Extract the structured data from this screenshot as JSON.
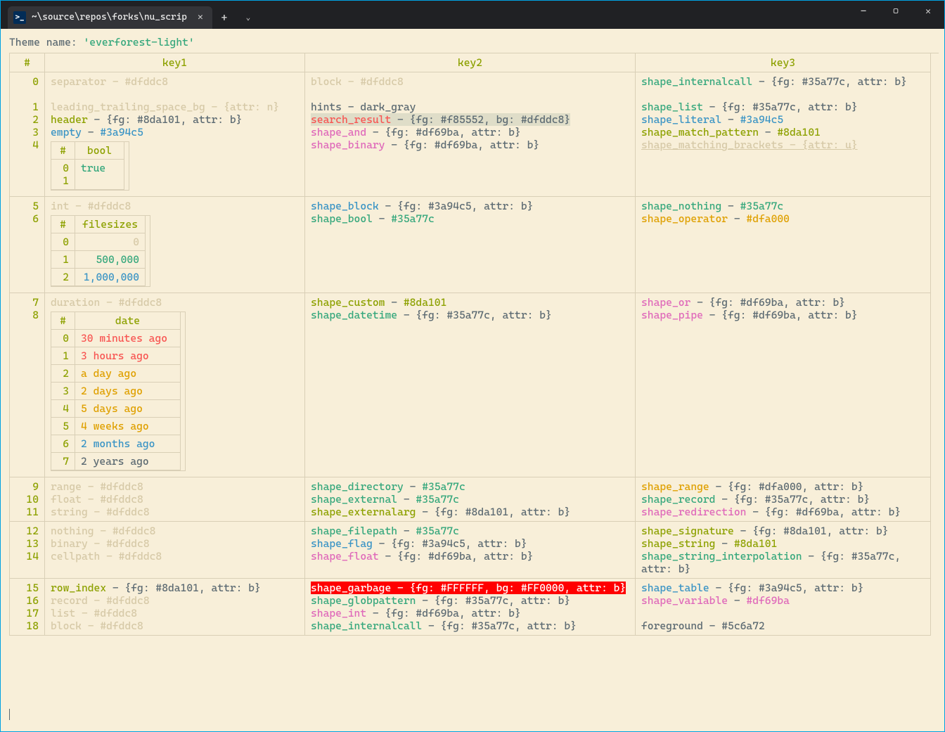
{
  "tab_title": "~\\source\\repos\\forks\\nu_scrip",
  "theme_label": "Theme name:",
  "theme_name": "'everforest-light'",
  "headers": {
    "idx": "#",
    "k1": "key1",
    "k2": "key2",
    "k3": "key3"
  },
  "rows": {
    "r0": "0",
    "r1": "1",
    "r2": "2",
    "r3": "3",
    "r4": "4",
    "r5": "5",
    "r6": "6",
    "r7": "7",
    "r8": "8",
    "r9": "9",
    "r10": "10",
    "r11": "11",
    "r12": "12",
    "r13": "13",
    "r14": "14",
    "r15": "15",
    "r16": "16",
    "r17": "17",
    "r18": "18"
  },
  "k1": {
    "separator": "separator - #dfddc8",
    "leading": "leading_trailing_space_bg - {attr: n}",
    "header_k": "header",
    "header_v": " - {fg: #8da101, attr: b}",
    "empty_k": "empty",
    "empty_v": " - ",
    "empty_c": "#3a94c5",
    "int": "int - #dfddc8",
    "duration": "duration - #dfddc8",
    "range": "range - #dfddc8",
    "float": "float - #dfddc8",
    "string": "string - #dfddc8",
    "nothing": "nothing - #dfddc8",
    "binary": "binary - #dfddc8",
    "cellpath": "cellpath - #dfddc8",
    "row_index_k": "row_index",
    "row_index_v": " - {fg: #8da101, attr: b}",
    "record": "record - #dfddc8",
    "list": "list - #dfddc8",
    "block": "block - #dfddc8"
  },
  "k2": {
    "block": "block - #dfddc8",
    "hints": "hints - dark_gray",
    "search_k": "search_result",
    "search_v": " - {fg: #f85552, bg: #dfddc8}",
    "shape_and_k": "shape_and",
    "shape_and_v": " - {fg: #df69ba, attr: b}",
    "shape_binary_k": "shape_binary",
    "shape_binary_v": " - {fg: #df69ba, attr: b}",
    "shape_block_k": "shape_block",
    "shape_block_v": " - {fg: #3a94c5, attr: b}",
    "shape_bool_k": "shape_bool",
    "shape_bool_v": " - ",
    "shape_bool_c": "#35a77c",
    "shape_custom_k": "shape_custom",
    "shape_custom_v": " - ",
    "shape_custom_c": "#8da101",
    "shape_datetime_k": "shape_datetime",
    "shape_datetime_v": " - {fg: #35a77c, attr: b}",
    "shape_directory_k": "shape_directory",
    "shape_directory_v": " - ",
    "shape_directory_c": "#35a77c",
    "shape_external_k": "shape_external",
    "shape_external_v": " - ",
    "shape_external_c": "#35a77c",
    "shape_externalarg_k": "shape_externalarg",
    "shape_externalarg_v": " - {fg: #8da101, attr: b}",
    "shape_filepath_k": "shape_filepath",
    "shape_filepath_v": " - ",
    "shape_filepath_c": "#35a77c",
    "shape_flag_k": "shape_flag",
    "shape_flag_v": " - {fg: #3a94c5, attr: b}",
    "shape_float_k": "shape_float",
    "shape_float_v": " - {fg: #df69ba, attr: b}",
    "shape_garbage": "shape_garbage - {fg: #FFFFFF, bg: #FF0000, attr: b}",
    "shape_globpattern_k": "shape_globpattern",
    "shape_globpattern_v": " - {fg: #35a77c, attr: b}",
    "shape_int_k": "shape_int",
    "shape_int_v": " - {fg: #df69ba, attr: b}",
    "shape_internalcall_k": "shape_internalcall",
    "shape_internalcall_v": " - {fg: #35a77c, attr: b}"
  },
  "k3": {
    "shape_internalcall_k": "shape_internalcall",
    "shape_internalcall_v": " - {fg: #35a77c, attr: b}",
    "shape_list_k": "shape_list",
    "shape_list_v": " - {fg: #35a77c, attr: b}",
    "shape_literal_k": "shape_literal",
    "shape_literal_v": " - ",
    "shape_literal_c": "#3a94c5",
    "shape_match_pattern_k": "shape_match_pattern",
    "shape_match_pattern_v": " - ",
    "shape_match_pattern_c": "#8da101",
    "shape_matching_brackets": "shape_matching_brackets - {attr: u}",
    "shape_nothing_k": "shape_nothing",
    "shape_nothing_v": " - ",
    "shape_nothing_c": "#35a77c",
    "shape_operator_k": "shape_operator",
    "shape_operator_v": " - ",
    "shape_operator_c": "#dfa000",
    "shape_or_k": "shape_or",
    "shape_or_v": " - {fg: #df69ba, attr: b}",
    "shape_pipe_k": "shape_pipe",
    "shape_pipe_v": " - {fg: #df69ba, attr: b}",
    "shape_range_k": "shape_range",
    "shape_range_v": " - {fg: #dfa000, attr: b}",
    "shape_record_k": "shape_record",
    "shape_record_v": " - {fg: #35a77c, attr: b}",
    "shape_redirection_k": "shape_redirection",
    "shape_redirection_v": " - {fg: #df69ba, attr: b}",
    "shape_signature_k": "shape_signature",
    "shape_signature_v": " - {fg: #8da101, attr: b}",
    "shape_string_k": "shape_string",
    "shape_string_v": " - ",
    "shape_string_c": "#8da101",
    "shape_string_interp_k": "shape_string_interpolation",
    "shape_string_interp_v": " - {fg: #35a77c, attr: b}",
    "shape_table_k": "shape_table",
    "shape_table_v": " - {fg: #3a94c5, attr: b}",
    "shape_variable_k": "shape_variable",
    "shape_variable_v": " - ",
    "shape_variable_c": "#df69ba",
    "foreground_k": "foreground",
    "foreground_v": " - ",
    "foreground_c": "#5c6a72"
  },
  "bool_table": {
    "hdr_idx": "#",
    "hdr_col": "bool",
    "r0": "0",
    "r1": "1",
    "v": "true"
  },
  "filesize_table": {
    "hdr_idx": "#",
    "hdr_col": "filesizes",
    "r0": "0",
    "r1": "1",
    "r2": "2",
    "v0": "0",
    "v1": "500,000",
    "v2": "1,000,000"
  },
  "date_table": {
    "hdr_idx": "#",
    "hdr_col": "date",
    "r0": "0",
    "r1": "1",
    "r2": "2",
    "r3": "3",
    "r4": "4",
    "r5": "5",
    "r6": "6",
    "r7": "7",
    "v0": "30 minutes ago",
    "v1": "3 hours ago",
    "v2": "a day ago",
    "v3": "2 days ago",
    "v4": "5 days ago",
    "v5": "4 weeks ago",
    "v6": "2 months ago",
    "v7": "2 years ago"
  }
}
